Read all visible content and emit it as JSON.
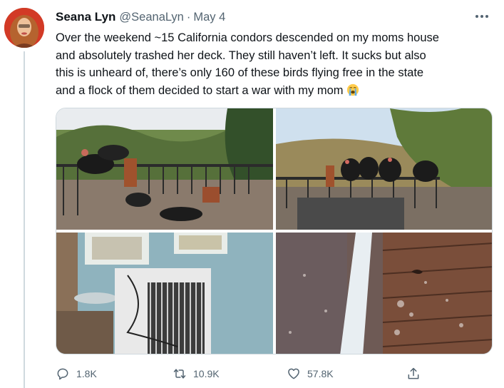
{
  "tweet": {
    "author_name": "Seana Lyn",
    "handle": "@SeanaLyn",
    "separator": "·",
    "date": "May 4",
    "text_lines": [
      "Over the weekend ~15 California condors descended on my moms house",
      "and absolutely trashed her deck. They still haven’t left. It sucks but also",
      "this is unheard of, there’s only 160 of these birds flying free in the state",
      "and a flock of them decided to start a war with my mom"
    ],
    "emoji_icon": "loudly-crying-face-icon"
  },
  "actions": {
    "reply_count": "1.8K",
    "retweet_count": "10.9K",
    "like_count": "57.8K",
    "reply_icon": "reply-icon",
    "retweet_icon": "retweet-icon",
    "like_icon": "heart-icon",
    "share_icon": "share-icon"
  },
  "colors": {
    "text": "#0f1419",
    "secondary": "#536471",
    "border": "#cfd9de"
  }
}
